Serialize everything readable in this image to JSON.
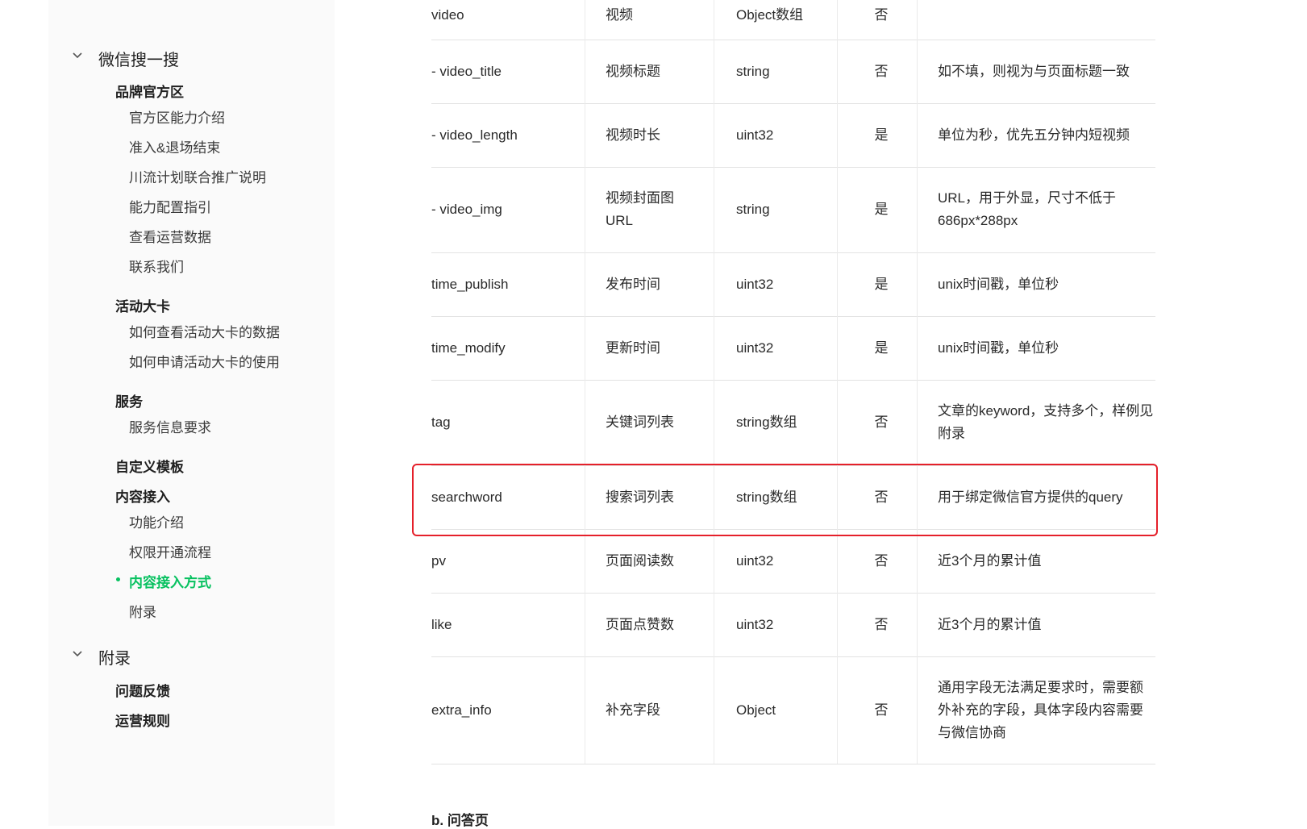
{
  "sidebar": {
    "groups": [
      {
        "title": "微信搜一搜",
        "sections": [
          {
            "title": "品牌官方区",
            "items": [
              "官方区能力介绍",
              "准入&退场结束",
              "川流计划联合推广说明",
              "能力配置指引",
              "查看运营数据",
              "联系我们"
            ]
          },
          {
            "title": "活动大卡",
            "items": [
              "如何查看活动大卡的数据",
              "如何申请活动大卡的使用"
            ]
          },
          {
            "title": "服务",
            "items": [
              "服务信息要求"
            ]
          },
          {
            "title": "自定义模板",
            "items": []
          },
          {
            "title": "内容接入",
            "items": [
              "功能介绍",
              "权限开通流程",
              "内容接入方式",
              "附录"
            ]
          }
        ]
      },
      {
        "title": "附录",
        "sections": [
          {
            "title": "问题反馈",
            "items": []
          },
          {
            "title": "运营规则",
            "items": []
          }
        ]
      }
    ],
    "active_item": "内容接入方式",
    "accent_color": "#07c160"
  },
  "table": {
    "rows": [
      [
        "video",
        "视频",
        "Object数组",
        "否",
        ""
      ],
      [
        "- video_title",
        "视频标题",
        "string",
        "否",
        "如不填，则视为与页面标题一致"
      ],
      [
        "- video_length",
        "视频时长",
        "uint32",
        "是",
        "单位为秒，优先五分钟内短视频"
      ],
      [
        "- video_img",
        "视频封面图URL",
        "string",
        "是",
        "URL，用于外显，尺寸不低于686px*288px"
      ],
      [
        "time_publish",
        "发布时间",
        "uint32",
        "是",
        "unix时间戳，单位秒"
      ],
      [
        "time_modify",
        "更新时间",
        "uint32",
        "是",
        "unix时间戳，单位秒"
      ],
      [
        "tag",
        "关键词列表",
        "string数组",
        "否",
        "文章的keyword，支持多个，样例见附录"
      ],
      [
        "searchword",
        "搜索词列表",
        "string数组",
        "否",
        "用于绑定微信官方提供的query"
      ],
      [
        "pv",
        "页面阅读数",
        "uint32",
        "否",
        "近3个月的累计值"
      ],
      [
        "like",
        "页面点赞数",
        "uint32",
        "否",
        "近3个月的累计值"
      ],
      [
        "extra_info",
        "补充字段",
        "Object",
        "否",
        "通用字段无法满足要求时，需要额外补充的字段，具体字段内容需要与微信协商"
      ]
    ],
    "highlighted_field": "searchword",
    "highlight_color": "#e5202a"
  },
  "next_section_heading": "b. 问答页"
}
